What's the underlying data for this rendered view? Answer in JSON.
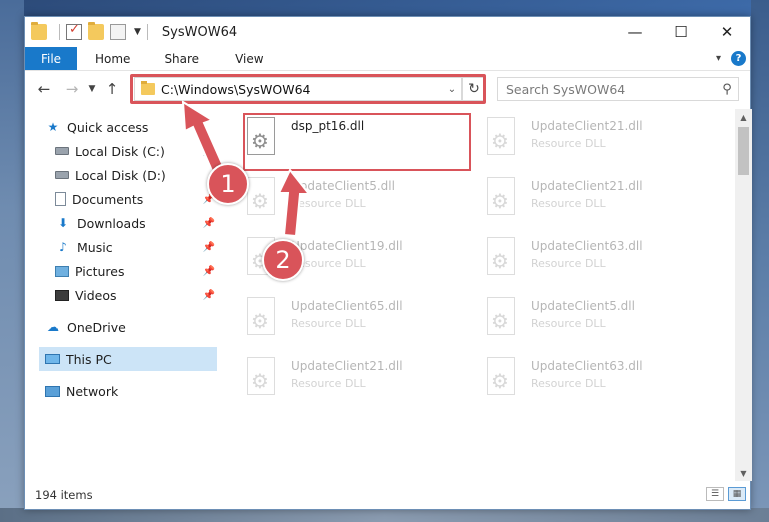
{
  "window": {
    "title": "SysWOW64",
    "controls": {
      "minimize": "—",
      "maximize": "☐",
      "close": "✕"
    }
  },
  "ribbon": {
    "file": "File",
    "tabs": [
      "Home",
      "Share",
      "View"
    ],
    "help": "?"
  },
  "address": {
    "path": "C:\\Windows\\SysWOW64",
    "search_placeholder": "Search SysWOW64"
  },
  "sidebar": {
    "quick_access": "Quick access",
    "items": [
      "Local Disk (C:)",
      "Local Disk (D:)",
      "Documents",
      "Downloads",
      "Music",
      "Pictures",
      "Videos"
    ],
    "onedrive": "OneDrive",
    "this_pc": "This PC",
    "network": "Network"
  },
  "files": [
    {
      "name": "dsp_pt16.dll",
      "type": "",
      "faded": false
    },
    {
      "name": "UpdateClient21.dll",
      "type": "Resource DLL",
      "faded": true
    },
    {
      "name": "UpdateClient5.dll",
      "type": "Resource DLL",
      "faded": true
    },
    {
      "name": "UpdateClient21.dll",
      "type": "Resource DLL",
      "faded": true
    },
    {
      "name": "UpdateClient19.dll",
      "type": "Resource DLL",
      "faded": true
    },
    {
      "name": "UpdateClient63.dll",
      "type": "Resource DLL",
      "faded": true
    },
    {
      "name": "UpdateClient65.dll",
      "type": "Resource DLL",
      "faded": true
    },
    {
      "name": "UpdateClient5.dll",
      "type": "Resource DLL",
      "faded": true
    },
    {
      "name": "UpdateClient21.dll",
      "type": "Resource DLL",
      "faded": true
    },
    {
      "name": "UpdateClient63.dll",
      "type": "Resource DLL",
      "faded": true
    }
  ],
  "status": {
    "count": "194 items"
  },
  "annotations": {
    "step1": "1",
    "step2": "2"
  },
  "colors": {
    "accent": "#1979ca",
    "highlight": "#d9545a"
  }
}
